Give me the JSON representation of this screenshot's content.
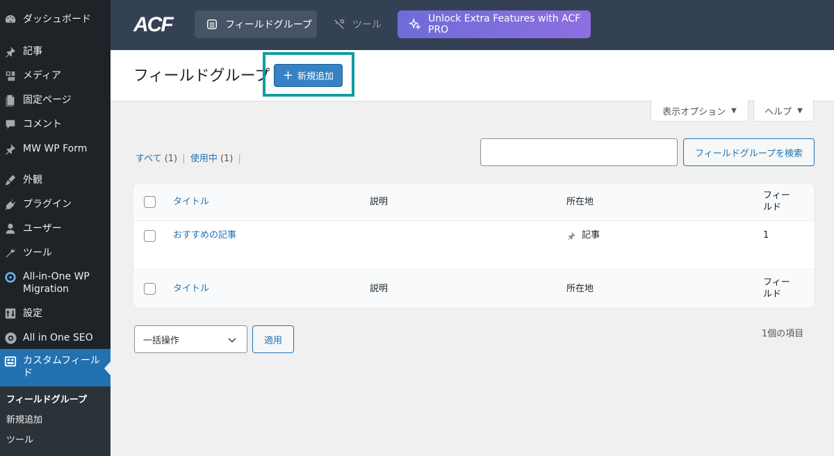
{
  "sidebar": {
    "items": [
      {
        "label": "ダッシュボード",
        "icon": "dashboard-icon"
      },
      {
        "label": "記事",
        "icon": "pin-icon"
      },
      {
        "label": "メディア",
        "icon": "media-icon"
      },
      {
        "label": "固定ページ",
        "icon": "page-icon"
      },
      {
        "label": "コメント",
        "icon": "comment-icon"
      },
      {
        "label": "MW WP Form",
        "icon": "pin-icon"
      },
      {
        "label": "外観",
        "icon": "appearance-icon"
      },
      {
        "label": "プラグイン",
        "icon": "plugin-icon"
      },
      {
        "label": "ユーザー",
        "icon": "user-icon"
      },
      {
        "label": "ツール",
        "icon": "wrench-icon"
      },
      {
        "label": "All-in-One WP Migration",
        "icon": "migration-icon"
      },
      {
        "label": "設定",
        "icon": "settings-icon"
      },
      {
        "label": "All in One SEO",
        "icon": "seo-icon"
      },
      {
        "label": "カスタムフィールド",
        "icon": "custom-fields-icon"
      }
    ],
    "submenu": [
      "フィールドグループ",
      "新規追加",
      "ツール"
    ]
  },
  "acf_bar": {
    "logo": "ACF",
    "nav_fieldgroups": "フィールドグループ",
    "nav_tools": "ツール",
    "nav_unlock": "Unlock Extra Features with ACF PRO"
  },
  "header": {
    "title": "フィールドグループ",
    "add_new": "新規追加"
  },
  "screen_meta": {
    "screen_options": "表示オプション",
    "help": "ヘルプ"
  },
  "filters": {
    "all": "すべて",
    "all_count": "(1)",
    "active": "使用中",
    "active_count": "(1)",
    "sep": "|"
  },
  "search": {
    "value": "",
    "button": "フィールドグループを検索"
  },
  "table": {
    "headers": {
      "title": "タイトル",
      "description": "説明",
      "location": "所在地",
      "fields": "フィールド"
    },
    "rows": [
      {
        "title": "おすすめの記事",
        "description": "",
        "location": "記事",
        "fields": "1"
      }
    ]
  },
  "bulk": {
    "selected": "一括操作",
    "apply": "適用",
    "items_count": "1個の項目"
  },
  "colors": {
    "sidebar_bg": "#1d2327",
    "active_menu": "#2271b1",
    "acf_bar": "#344054",
    "highlight": "#0f9e9e",
    "primary_button": "#3582c4"
  }
}
